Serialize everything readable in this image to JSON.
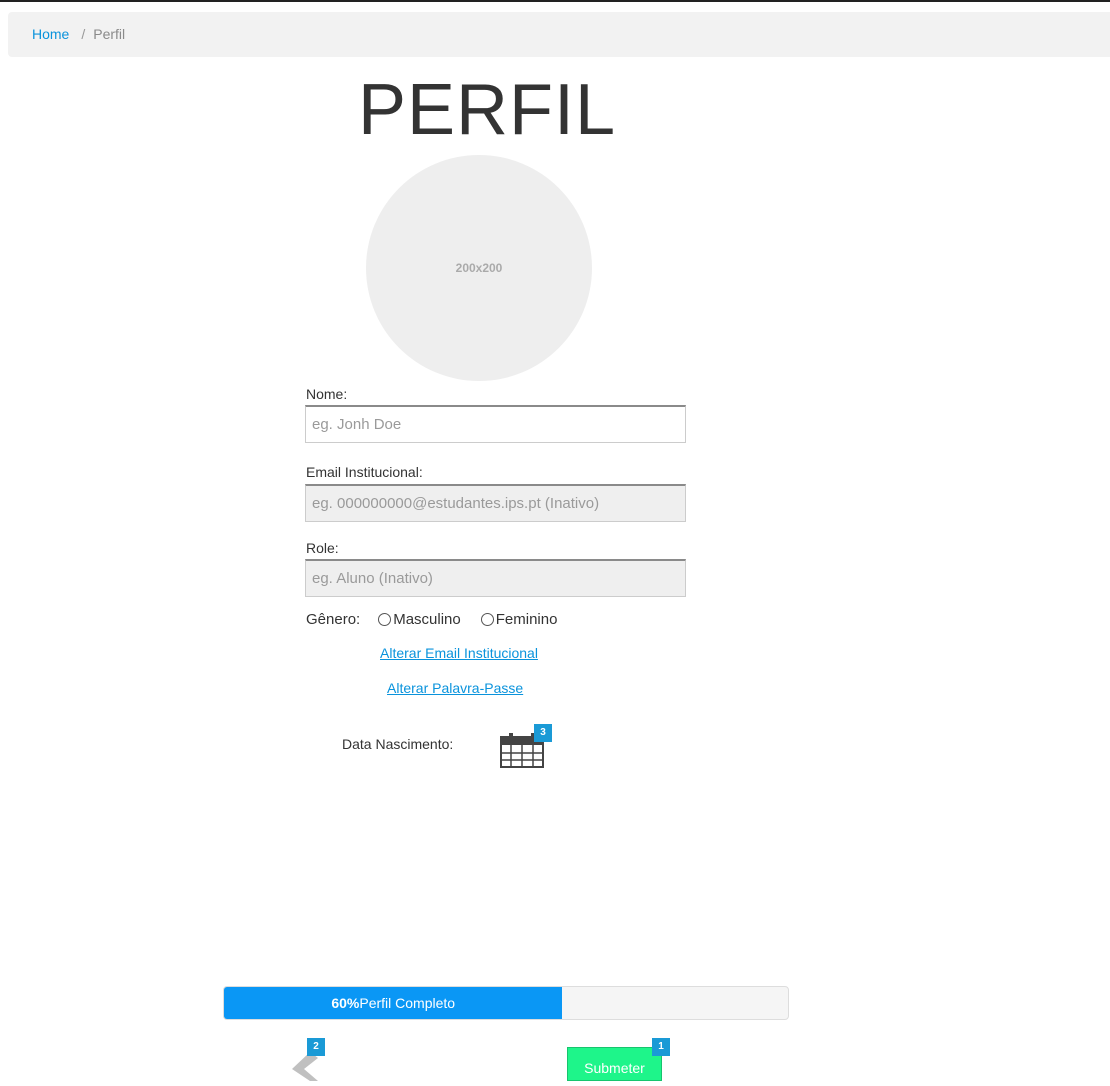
{
  "breadcrumb": {
    "home": "Home",
    "separator": "/",
    "current": "Perfil"
  },
  "page": {
    "title": "PERFIL"
  },
  "avatar": {
    "placeholder_text": "200x200"
  },
  "form": {
    "nome": {
      "label": "Nome:",
      "placeholder": "eg. Jonh Doe",
      "value": ""
    },
    "email": {
      "label": "Email Institucional:",
      "placeholder": "eg. 000000000@estudantes.ips.pt (Inativo)",
      "value": ""
    },
    "role": {
      "label": "Role:",
      "placeholder": "eg. Aluno (Inativo)",
      "value": ""
    },
    "genero": {
      "label": "Gênero:",
      "options": [
        "Masculino",
        "Feminino"
      ],
      "selected": null
    },
    "links": {
      "alterar_email": "Alterar Email Institucional",
      "alterar_password": "Alterar Palavra-Passe"
    },
    "data_nascimento": {
      "label": "Data Nascimento:",
      "icon": "calendar-icon",
      "badge": "3"
    }
  },
  "progress": {
    "percent": 60,
    "percent_label": "60%",
    "label": "Perfil Completo"
  },
  "actions": {
    "back_icon": "chevron-left-icon",
    "back_badge": "2",
    "submit_label": "Submeter",
    "submit_badge": "1"
  },
  "colors": {
    "link": "#0a93dc",
    "progress_fill": "#0a97f5",
    "submit_bg": "#1ef58a",
    "badge_bg": "#1a9ad6"
  }
}
